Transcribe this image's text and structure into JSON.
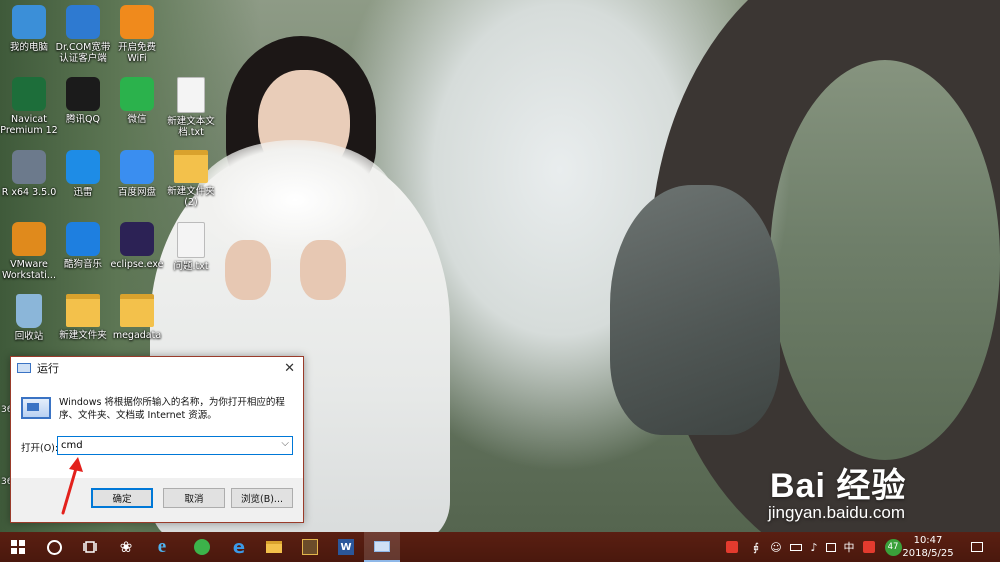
{
  "desktop": {
    "icons": [
      {
        "label": "我的电脑",
        "icon": "computer-icon",
        "color": "#3b8fd8"
      },
      {
        "label": "Dr.COM宽带\n认证客户端",
        "icon": "drcom-icon",
        "color": "#2e7ad1"
      },
      {
        "label": "开启免费\nWiFi",
        "icon": "wifi-icon",
        "color": "#f08a1c"
      },
      {
        "label": "Navicat\nPremium 12",
        "icon": "navicat-icon",
        "color": "#1d6e3a"
      },
      {
        "label": "腾讯QQ",
        "icon": "qq-icon",
        "color": "#1b1b1b"
      },
      {
        "label": "微信",
        "icon": "wechat-icon",
        "color": "#2bb24c"
      },
      {
        "label": "新建文本文\n档.txt",
        "icon": "text-file-icon",
        "color": "#f4f4f4"
      },
      {
        "label": "R x64 3.5.0",
        "icon": "r-icon",
        "color": "#6c7a8c"
      },
      {
        "label": "迅雷",
        "icon": "thunder-icon",
        "color": "#1e8ce6"
      },
      {
        "label": "百度网盘",
        "icon": "baidu-netdisk-icon",
        "color": "#3a8ef0"
      },
      {
        "label": "新建文件夹\n(2)",
        "icon": "folder-icon",
        "color": "#f3c14b"
      },
      {
        "label": "VMware\nWorkstati...",
        "icon": "vmware-icon",
        "color": "#e08a1c"
      },
      {
        "label": "酷狗音乐",
        "icon": "kugou-icon",
        "color": "#1e7fe0"
      },
      {
        "label": "eclipse.exe",
        "icon": "eclipse-icon",
        "color": "#2c2255"
      },
      {
        "label": "问题.txt",
        "icon": "text-file-icon",
        "color": "#f4f4f4"
      },
      {
        "label": "回收站",
        "icon": "recycle-bin-icon",
        "color": "#8bb6d9"
      },
      {
        "label": "新建文件夹",
        "icon": "folder-icon",
        "color": "#f3c14b"
      },
      {
        "label": "megadata",
        "icon": "folder-icon",
        "color": "#f3c14b"
      }
    ],
    "partial_labels": [
      "36",
      "36"
    ]
  },
  "run_dialog": {
    "title": "运行",
    "description": "Windows 将根据你所输入的名称，为你打开相应的程序、文件夹、文档或 Internet 资源。",
    "open_label": "打开(O):",
    "input_value": "cmd",
    "ok_label": "确定",
    "cancel_label": "取消",
    "browse_label": "浏览(B)..."
  },
  "taskbar": {
    "pinned": [
      {
        "name": "start",
        "icon": "windows-start-icon"
      },
      {
        "name": "search",
        "icon": "cortana-circle-icon"
      },
      {
        "name": "task-view",
        "icon": "task-view-icon"
      },
      {
        "name": "app-1",
        "icon": "butterfly-icon"
      },
      {
        "name": "ie",
        "icon": "internet-explorer-icon"
      },
      {
        "name": "app-green",
        "icon": "green-browser-icon"
      },
      {
        "name": "edge",
        "icon": "edge-icon"
      },
      {
        "name": "file-explorer",
        "icon": "folder-icon"
      },
      {
        "name": "app-game",
        "icon": "game-icon"
      },
      {
        "name": "word",
        "icon": "word-icon"
      },
      {
        "name": "run",
        "icon": "run-icon"
      }
    ],
    "tray": {
      "badge_count": "47",
      "ime": "中",
      "time": "10:47",
      "date": "2018/5/25"
    }
  },
  "watermark": {
    "logo": "Bai 经验",
    "url": "jingyan.baidu.com"
  },
  "colors": {
    "taskbar_bg": "#4a180d",
    "dialog_border": "#9a3b2a",
    "accent_blue": "#0078d7"
  }
}
